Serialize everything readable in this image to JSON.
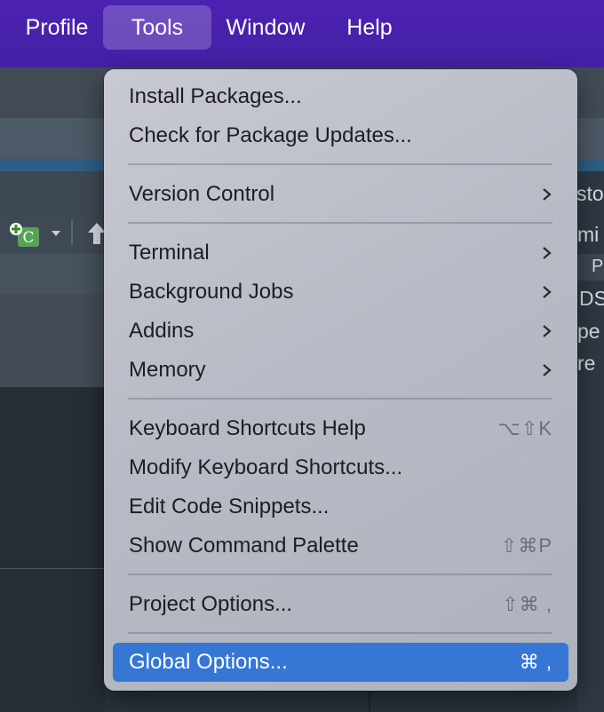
{
  "menubar": {
    "items": [
      {
        "label": "Profile"
      },
      {
        "label": "Tools"
      },
      {
        "label": "Window"
      },
      {
        "label": "Help"
      }
    ]
  },
  "background": {
    "right_fragments": [
      "sto",
      "mi",
      "Pa",
      "DS",
      "pe",
      "re"
    ]
  },
  "tools_menu": {
    "items": [
      {
        "label": "Install Packages..."
      },
      {
        "label": "Check for Package Updates..."
      },
      {
        "label": "Version Control"
      },
      {
        "label": "Terminal"
      },
      {
        "label": "Background Jobs"
      },
      {
        "label": "Addins"
      },
      {
        "label": "Memory"
      },
      {
        "label": "Keyboard Shortcuts Help",
        "shortcut": "⌥⇧K"
      },
      {
        "label": "Modify Keyboard Shortcuts..."
      },
      {
        "label": "Edit Code Snippets..."
      },
      {
        "label": "Show Command Palette",
        "shortcut": "⇧⌘P"
      },
      {
        "label": "Project Options...",
        "shortcut": "⇧⌘ ,"
      },
      {
        "label": "Global Options...",
        "shortcut": "⌘ ,"
      }
    ]
  },
  "colors": {
    "menubar": "#4a21ad",
    "menu_background": "#b9bcc6",
    "selection": "#3677d6"
  }
}
